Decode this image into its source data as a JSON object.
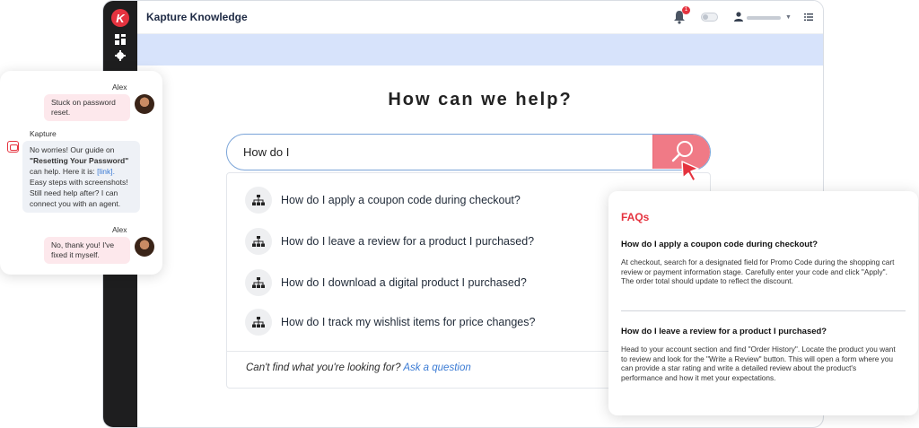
{
  "app": {
    "title": "Kapture Knowledge",
    "logo_letter": "K",
    "notification_count": "1"
  },
  "colors": {
    "brand": "#e5333f",
    "sidebar": "#1e1e1f",
    "banner": "#d7e3fb",
    "search_button": "#f07a86",
    "link": "#3b7bd4"
  },
  "help": {
    "title": "How can we help?"
  },
  "search": {
    "value": "How do I",
    "icon": "search-icon"
  },
  "results": [
    {
      "icon": "sitemap-icon",
      "text": "How do I apply a coupon code during checkout?"
    },
    {
      "icon": "sitemap-icon",
      "text": "How do I leave a review for a product I purchased?"
    },
    {
      "icon": "sitemap-icon",
      "text": "How do I download a digital product I purchased?"
    },
    {
      "icon": "sitemap-icon",
      "text": "How do I track my wishlist items for price changes?"
    }
  ],
  "footer": {
    "prompt": "Can't find what you're looking for?",
    "link": "Ask a question"
  },
  "chat": {
    "messages": [
      {
        "sender": "Alex",
        "role": "user",
        "text": "Stuck on password reset."
      },
      {
        "sender": "Kapture",
        "role": "bot",
        "text_1": "No worries! Our guide on",
        "bold": "\"Resetting Your Password\"",
        "text_2": "can help. Here it is:",
        "link": "[link].",
        "text_3": "Easy steps with screenshots! Still need help after? I can connect you with an agent."
      },
      {
        "sender": "Alex",
        "role": "user",
        "text": "No, thank you! I've fixed it myself."
      }
    ]
  },
  "faq": {
    "title": "FAQs",
    "items": [
      {
        "question": "How do I apply a coupon code during checkout?",
        "answer": "At checkout, search for a designated field for Promo Code during the shopping cart review or payment information stage.  Carefully enter your code and click \"Apply\". The order total should update to reflect the discount."
      },
      {
        "question": "How do I leave a review for a product I purchased?",
        "answer": "Head to your account section and find \"Order History\". Locate the product you want to review and look for the \"Write a Review\" button. This will open a form where you can provide a star rating and write a detailed review about the product's performance and how it met your expectations."
      }
    ]
  }
}
